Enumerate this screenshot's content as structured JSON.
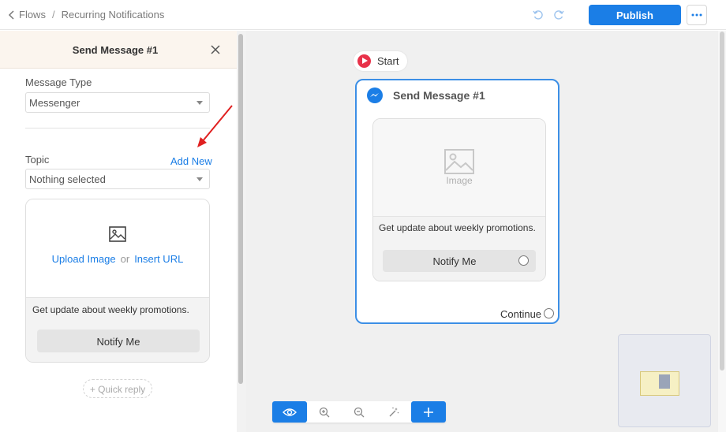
{
  "breadcrumb": {
    "root": "Flows",
    "separator": "/",
    "current": "Recurring Notifications"
  },
  "header": {
    "publish_label": "Publish"
  },
  "panel": {
    "title": "Send Message #1",
    "message_type": {
      "label": "Message Type",
      "value": "Messenger"
    },
    "topic": {
      "label": "Topic",
      "add_new": "Add New",
      "value": "Nothing selected"
    },
    "card": {
      "upload_image": "Upload Image",
      "or": "or",
      "insert_url": "Insert URL",
      "text": "Get update about weekly promotions.",
      "button_label": "Notify Me"
    },
    "quick_reply": "+ Quick reply"
  },
  "canvas": {
    "start_label": "Start",
    "node": {
      "title": "Send Message #1",
      "image_label": "Image",
      "text": "Get update about weekly promotions.",
      "button_label": "Notify Me",
      "continue_label": "Continue"
    }
  },
  "colors": {
    "accent": "#1b7ee6",
    "start": "#e8324a",
    "node_border": "#3c8fe6",
    "arrow": "#e02020"
  },
  "icons": {
    "back": "chevron-left-icon",
    "undo": "undo-icon",
    "redo": "redo-icon",
    "more": "ellipsis-icon",
    "close": "close-icon",
    "image": "image-icon",
    "messenger": "messenger-icon",
    "eye": "eye-icon",
    "zoom_in": "zoom-in-icon",
    "zoom_out": "zoom-out-icon",
    "magic": "magic-wand-icon",
    "add": "plus-icon"
  }
}
